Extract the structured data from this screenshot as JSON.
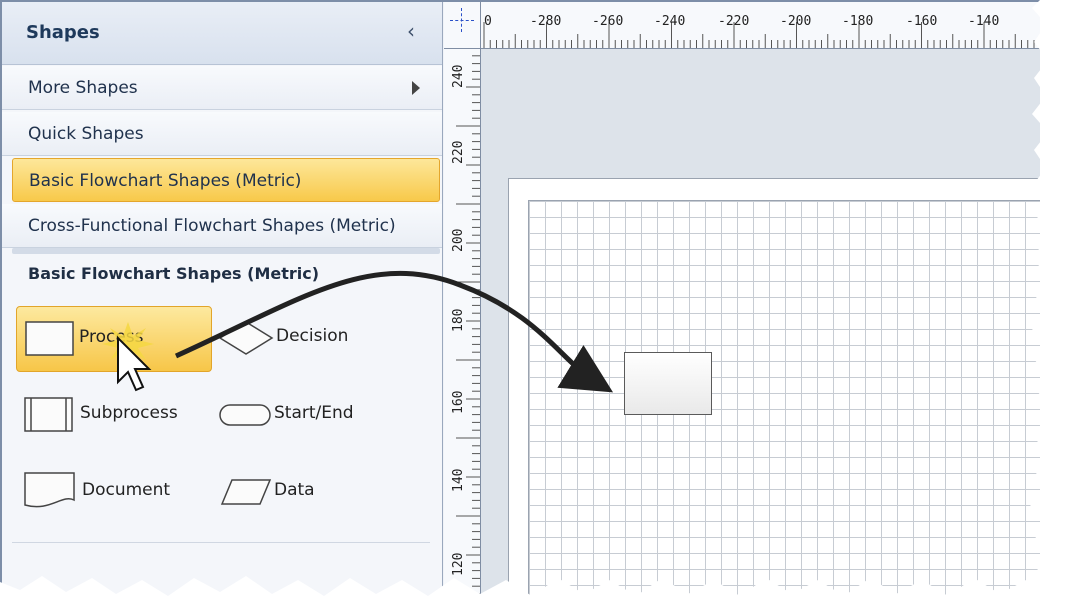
{
  "pane": {
    "title": "Shapes",
    "stencils": [
      {
        "label": "More Shapes"
      },
      {
        "label": "Quick Shapes"
      },
      {
        "label": "Basic Flowchart Shapes (Metric)"
      },
      {
        "label": "Cross-Functional Flowchart Shapes (Metric)"
      }
    ],
    "section_title": "Basic Flowchart Shapes (Metric)",
    "shapes": [
      {
        "label": "Process",
        "icon": "process-rectangle-icon"
      },
      {
        "label": "Decision",
        "icon": "diamond-icon"
      },
      {
        "label": "Subprocess",
        "icon": "subprocess-icon"
      },
      {
        "label": "Start/End",
        "icon": "terminator-icon"
      },
      {
        "label": "Document",
        "icon": "document-shape-icon"
      },
      {
        "label": "Data",
        "icon": "parallelogram-icon"
      }
    ]
  },
  "ruler": {
    "top_labels": [
      "0",
      "-280",
      "-260",
      "-240",
      "-220",
      "-200",
      "-180",
      "-160",
      "-140"
    ],
    "left_labels": [
      "240",
      "220",
      "200",
      "180",
      "160",
      "140",
      "120"
    ]
  },
  "colors": {
    "selection": "#f8c94a",
    "pane_title": "#1e395b",
    "grid": "#c7ccd3"
  }
}
